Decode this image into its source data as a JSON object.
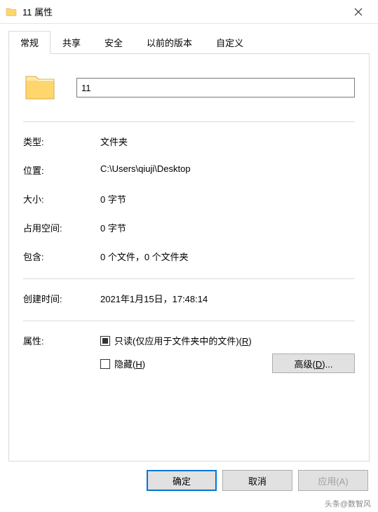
{
  "window": {
    "title": "11 属性"
  },
  "tabs": {
    "general": "常规",
    "sharing": "共享",
    "security": "安全",
    "previous": "以前的版本",
    "custom": "自定义"
  },
  "folder_name": "11",
  "labels": {
    "type": "类型:",
    "location": "位置:",
    "size": "大小:",
    "size_on_disk": "占用空间:",
    "contains": "包含:",
    "created": "创建时间:",
    "attributes": "属性:"
  },
  "values": {
    "type": "文件夹",
    "location": "C:\\Users\\qiuji\\Desktop",
    "size": "0 字节",
    "size_on_disk": "0 字节",
    "contains": "0 个文件，0 个文件夹",
    "created": "2021年1月15日，17:48:14"
  },
  "attributes": {
    "readonly_text": "只读(仅应用于文件夹中的文件)(",
    "readonly_key": "R",
    "readonly_suffix": ")",
    "hidden_text": "隐藏(",
    "hidden_key": "H",
    "hidden_suffix": ")",
    "advanced_text": "高级(",
    "advanced_key": "D",
    "advanced_suffix": ")..."
  },
  "buttons": {
    "ok": "确定",
    "cancel": "取消",
    "apply": "应用(A)"
  },
  "watermark": "头条@数智风"
}
